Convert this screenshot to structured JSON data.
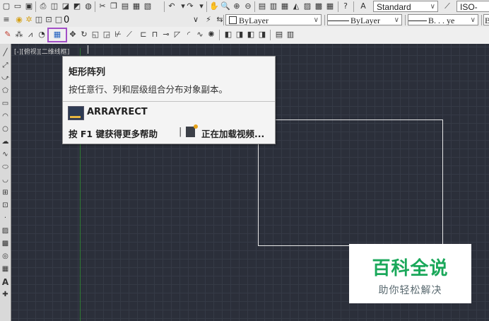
{
  "toolbar_row2": {
    "layer_value": "0",
    "color_combo": "ByLayer",
    "linetype_combo": "ByLayer",
    "lineweight_combo": "B. . . ye",
    "cut_text": "By"
  },
  "toolbar_row1": {
    "text_style_combo": "Standard",
    "dim_style_combo": "ISO-"
  },
  "viewport_label": "[-][俯视][二维线框]",
  "tooltip": {
    "title": "矩形阵列",
    "description": "按任意行、列和层级组合分布对象副本。",
    "command": "ARRAYRECT",
    "help": "按 F1 键获得更多帮助",
    "separator": "|",
    "video": "正在加载视频..."
  },
  "watermark": {
    "main": "百科全说",
    "sub": "助你轻松解决"
  },
  "colors": {
    "canvas": "#2b2f3a",
    "grid": "#353a46",
    "highlight": "#a24fc6",
    "y_axis": "#2f7d33",
    "watermark_green": "#1aa85a"
  }
}
